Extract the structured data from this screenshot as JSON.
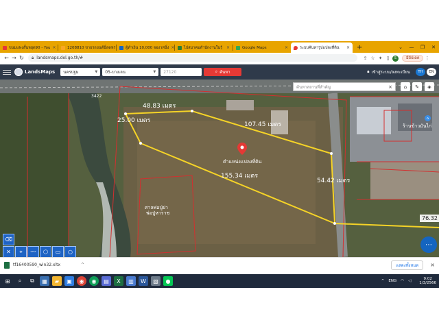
{
  "browser": {
    "tabs": [
      {
        "label": "ขนมแพงสั้นหยุด90 - You",
        "fav": "#e53935"
      },
      {
        "label": "1208810 ขายรถยนต์นี่ลดหรา",
        "fav": "#f9a825"
      },
      {
        "label": "ผู้ทำเงิน 10,000 จองวหนึ่ง",
        "fav": "#1565c0"
      },
      {
        "label": "ไปสมาคมสำนักงานในรุ้",
        "fav": "#2e7d32"
      },
      {
        "label": "Google Maps",
        "fav": "#34a853"
      },
      {
        "label": "ระบบค้นหารูปแปลงที่ดิน",
        "fav": "#e53935"
      }
    ],
    "new_tab_label": "+",
    "url": "landsmaps.dol.go.th/#",
    "profile_label": "มีอัปเดต",
    "profile_initial": "S"
  },
  "app": {
    "logo_text": "LandsMaps",
    "province": "นครปฐม",
    "district": "05-บางเลน",
    "parcel_placeholder": "27120",
    "search_label": "ค้นหา",
    "login_label": "เข้าสู่ระบบ/ลงทะเบียน",
    "lang_th": "TH",
    "lang_en": "EN"
  },
  "map": {
    "place_search_placeholder": "ค้นหาสถานที่สำคัญ",
    "place_search_clear": "×",
    "road_number": "3422",
    "marker_label": "ตำแหน่งแปลงที่ดิน",
    "measurements": [
      "48.83 เมตร",
      "25.00 เมตร",
      "107.45 เมตร",
      "155.34 เมตร",
      "54.42 เมตร",
      "76.32"
    ],
    "place_label_1": "ศาลพ่อปู่ย่า",
    "place_label_2": "พ่อปู่หาราช",
    "place_label_3": "ร้านข้าวมันไก่",
    "colors": {
      "boundary": "#f5d327",
      "parcel": "#d32f2f",
      "marker": "#e53935"
    }
  },
  "download": {
    "filename": "tf16400590_win32.xltx",
    "show_all": "แสดงทั้งหมด",
    "close": "×"
  },
  "taskbar": {
    "lang": "ENG",
    "time": "9:02",
    "date": "1/3/2566"
  }
}
